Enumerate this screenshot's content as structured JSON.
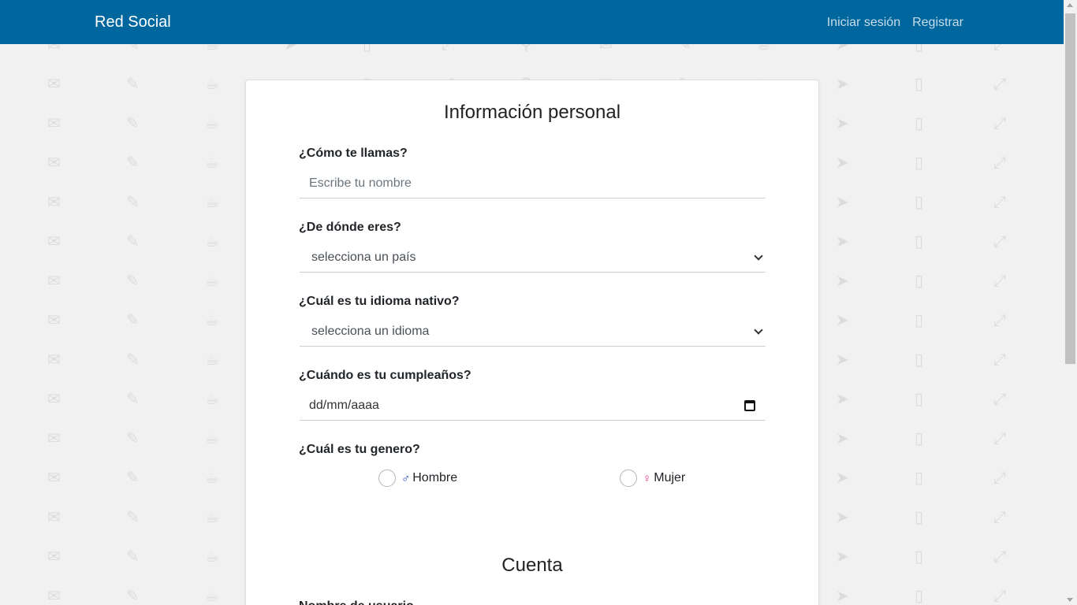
{
  "navbar": {
    "brand": "Red Social",
    "links": [
      "Iniciar sesión",
      "Registrar"
    ],
    "color": "#00669e"
  },
  "personal": {
    "title": "Información personal",
    "name": {
      "label": "¿Cómo te llamas?",
      "placeholder": "Escribe tu nombre"
    },
    "country": {
      "label": "¿De dónde eres?",
      "selected": "selecciona un país"
    },
    "language": {
      "label": "¿Cuál es tu idioma nativo?",
      "selected": "selecciona un idioma"
    },
    "birthday": {
      "label": "¿Cuándo es tu cumpleaños?",
      "placeholder": "dd/mm/aaaa"
    },
    "gender": {
      "label": "¿Cuál es tu genero?",
      "male_symbol": "♂",
      "male": "Hombre",
      "female_symbol": "♀",
      "female": "Mujer",
      "male_color": "#1f3fbf",
      "female_color": "#e8308a"
    }
  },
  "account": {
    "title": "Cuenta",
    "username_label": "Nombre de usuario"
  }
}
